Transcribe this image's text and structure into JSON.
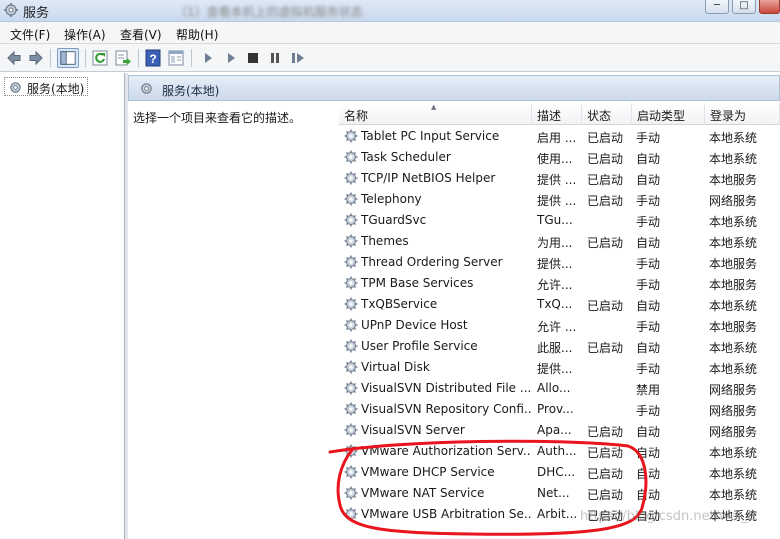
{
  "window": {
    "title": "服务",
    "blurred_caption": "（1）查看本机上的虚拟机服务状态",
    "minimize_label": "─",
    "restore_label": "□",
    "icon": "services-gear-icon"
  },
  "menubar": {
    "items": [
      "文件(F)",
      "操作(A)",
      "查看(V)",
      "帮助(H)"
    ]
  },
  "toolbar": {
    "icons": [
      "back-arrow-icon",
      "forward-arrow-icon",
      "console-tree-icon",
      "refresh-icon",
      "export-list-icon",
      "help-icon",
      "properties-icon",
      "start-service-icon",
      "start-service-alt-icon",
      "stop-service-icon",
      "pause-service-icon",
      "restart-service-icon"
    ]
  },
  "tree": {
    "selected_label": "服务(本地)"
  },
  "right_pane": {
    "header_title": "服务(本地)",
    "description_prompt": "选择一个项目来查看它的描述。"
  },
  "table": {
    "columns": [
      "名称",
      "描述",
      "状态",
      "启动类型",
      "登录为"
    ],
    "sorted_column": "名称",
    "rows": [
      {
        "name": "Tablet PC Input Service",
        "desc": "启用 ...",
        "status": "已启动",
        "startup": "手动",
        "logon": "本地系统"
      },
      {
        "name": "Task Scheduler",
        "desc": "使用...",
        "status": "已启动",
        "startup": "自动",
        "logon": "本地系统"
      },
      {
        "name": "TCP/IP NetBIOS Helper",
        "desc": "提供 ...",
        "status": "已启动",
        "startup": "自动",
        "logon": "本地服务"
      },
      {
        "name": "Telephony",
        "desc": "提供 ...",
        "status": "已启动",
        "startup": "手动",
        "logon": "网络服务"
      },
      {
        "name": "TGuardSvc",
        "desc": "TGu...",
        "status": "",
        "startup": "手动",
        "logon": "本地系统"
      },
      {
        "name": "Themes",
        "desc": "为用...",
        "status": "已启动",
        "startup": "自动",
        "logon": "本地系统"
      },
      {
        "name": "Thread Ordering Server",
        "desc": "提供...",
        "status": "",
        "startup": "手动",
        "logon": "本地服务"
      },
      {
        "name": "TPM Base Services",
        "desc": "允许...",
        "status": "",
        "startup": "手动",
        "logon": "本地服务"
      },
      {
        "name": "TxQBService",
        "desc": "TxQ...",
        "status": "已启动",
        "startup": "自动",
        "logon": "本地系统"
      },
      {
        "name": "UPnP Device Host",
        "desc": "允许 ...",
        "status": "",
        "startup": "手动",
        "logon": "本地服务"
      },
      {
        "name": "User Profile Service",
        "desc": "此服...",
        "status": "已启动",
        "startup": "自动",
        "logon": "本地系统"
      },
      {
        "name": "Virtual Disk",
        "desc": "提供...",
        "status": "",
        "startup": "手动",
        "logon": "本地系统"
      },
      {
        "name": "VisualSVN Distributed File ...",
        "desc": "Allo...",
        "status": "",
        "startup": "禁用",
        "logon": "网络服务"
      },
      {
        "name": "VisualSVN Repository Confi...",
        "desc": "Prov...",
        "status": "",
        "startup": "手动",
        "logon": "网络服务"
      },
      {
        "name": "VisualSVN Server",
        "desc": "Apa...",
        "status": "已启动",
        "startup": "自动",
        "logon": "网络服务"
      },
      {
        "name": "VMware Authorization Serv...",
        "desc": "Auth...",
        "status": "已启动",
        "startup": "自动",
        "logon": "本地系统"
      },
      {
        "name": "VMware DHCP Service",
        "desc": "DHC...",
        "status": "已启动",
        "startup": "自动",
        "logon": "本地系统"
      },
      {
        "name": "VMware NAT Service",
        "desc": "Net...",
        "status": "已启动",
        "startup": "自动",
        "logon": "本地系统"
      },
      {
        "name": "VMware USB Arbitration Se...",
        "desc": "Arbit...",
        "status": "已启动",
        "startup": "自动",
        "logon": "本地系统"
      }
    ]
  },
  "annotation": {
    "color": "#e8141e",
    "highlighted_rows": [
      "VMware Authorization Serv...",
      "VMware DHCP Service",
      "VMware NAT Service",
      "VMware USB Arbitration Se..."
    ]
  },
  "watermark": "https://blog.csdn.net/wei_lr"
}
